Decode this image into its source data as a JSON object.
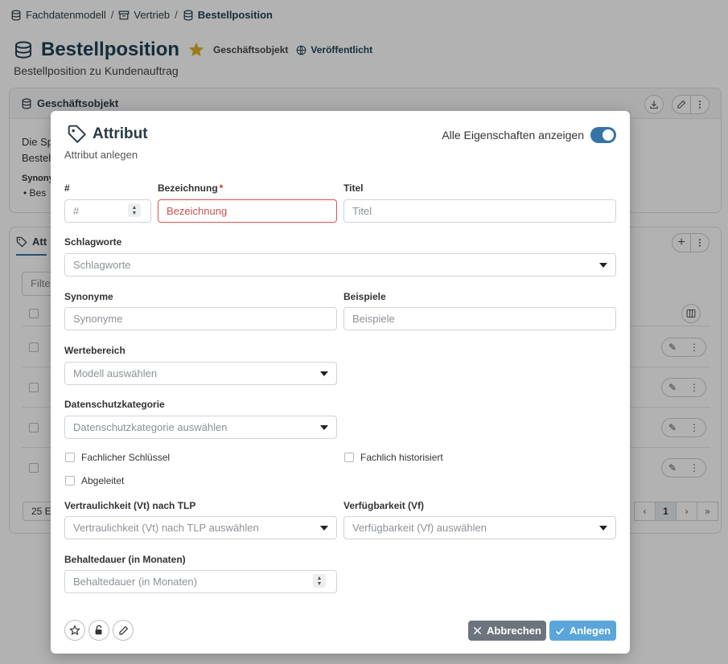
{
  "breadcrumb": [
    {
      "label": "Fachdatenmodell",
      "icon": "database-icon"
    },
    {
      "label": "Vertrieb",
      "icon": "archive-icon"
    },
    {
      "label": "Bestellposition",
      "icon": "database-icon"
    }
  ],
  "breadcrumb_sep": "/",
  "page": {
    "title": "Bestellposition",
    "type_label": "Geschäftsobjekt",
    "status_label": "Veröffentlicht",
    "subtitle": "Bestellposition zu Kundenauftrag"
  },
  "card1": {
    "title": "Geschäftsobjekt",
    "desc_line1": "Die Sp",
    "desc_line2": "Bestel",
    "syn_label": "Synony",
    "syn_item": "• Bes"
  },
  "card2": {
    "tab_label": "Att",
    "filter_placeholder": "Filte",
    "page_size": "25 E",
    "current_page": "1",
    "pager_prev": "‹",
    "pager_next": "›",
    "pager_last": "»"
  },
  "modal": {
    "title": "Attribut",
    "subtitle": "Attribut anlegen",
    "toggle_label": "Alle Eigenschaften anzeigen",
    "toggle_on": true,
    "fields": {
      "nr": {
        "label": "#",
        "placeholder": "#"
      },
      "bezeichnung": {
        "label": "Bezeichnung",
        "required_mark": "*",
        "placeholder": "Bezeichnung"
      },
      "titel": {
        "label": "Titel",
        "placeholder": "Titel"
      },
      "schlagworte": {
        "label": "Schlagworte",
        "placeholder": "Schlagworte"
      },
      "synonyme": {
        "label": "Synonyme",
        "placeholder": "Synonyme"
      },
      "beispiele": {
        "label": "Beispiele",
        "placeholder": "Beispiele"
      },
      "wertebereich": {
        "label": "Wertebereich",
        "placeholder": "Modell auswählen"
      },
      "datenschutz": {
        "label": "Datenschutzkategorie",
        "placeholder": "Datenschutzkategorie auswählen"
      },
      "vertraulichkeit": {
        "label": "Vertraulichkeit (Vt) nach TLP",
        "placeholder": "Vertraulichkeit (Vt) nach TLP auswählen"
      },
      "verfuegbarkeit": {
        "label": "Verfügbarkeit (Vf)",
        "placeholder": "Verfügbarkeit (Vf) auswählen"
      },
      "behaltedauer": {
        "label": "Behaltedauer (in Monaten)",
        "placeholder": "Behaltedauer (in Monaten)"
      }
    },
    "checkboxes": {
      "fachlicher_schluessel": "Fachlicher Schlüssel",
      "fachlich_historisiert": "Fachlich historisiert",
      "abgeleitet": "Abgeleitet"
    },
    "buttons": {
      "cancel": "Abbrechen",
      "create": "Anlegen"
    }
  },
  "colors": {
    "primary": "#3573a6",
    "title_dark": "#1f4154",
    "star": "#e0b128",
    "invalid": "#d9534f",
    "cancel_btn": "#6c757d",
    "create_btn": "#5aa6da"
  }
}
